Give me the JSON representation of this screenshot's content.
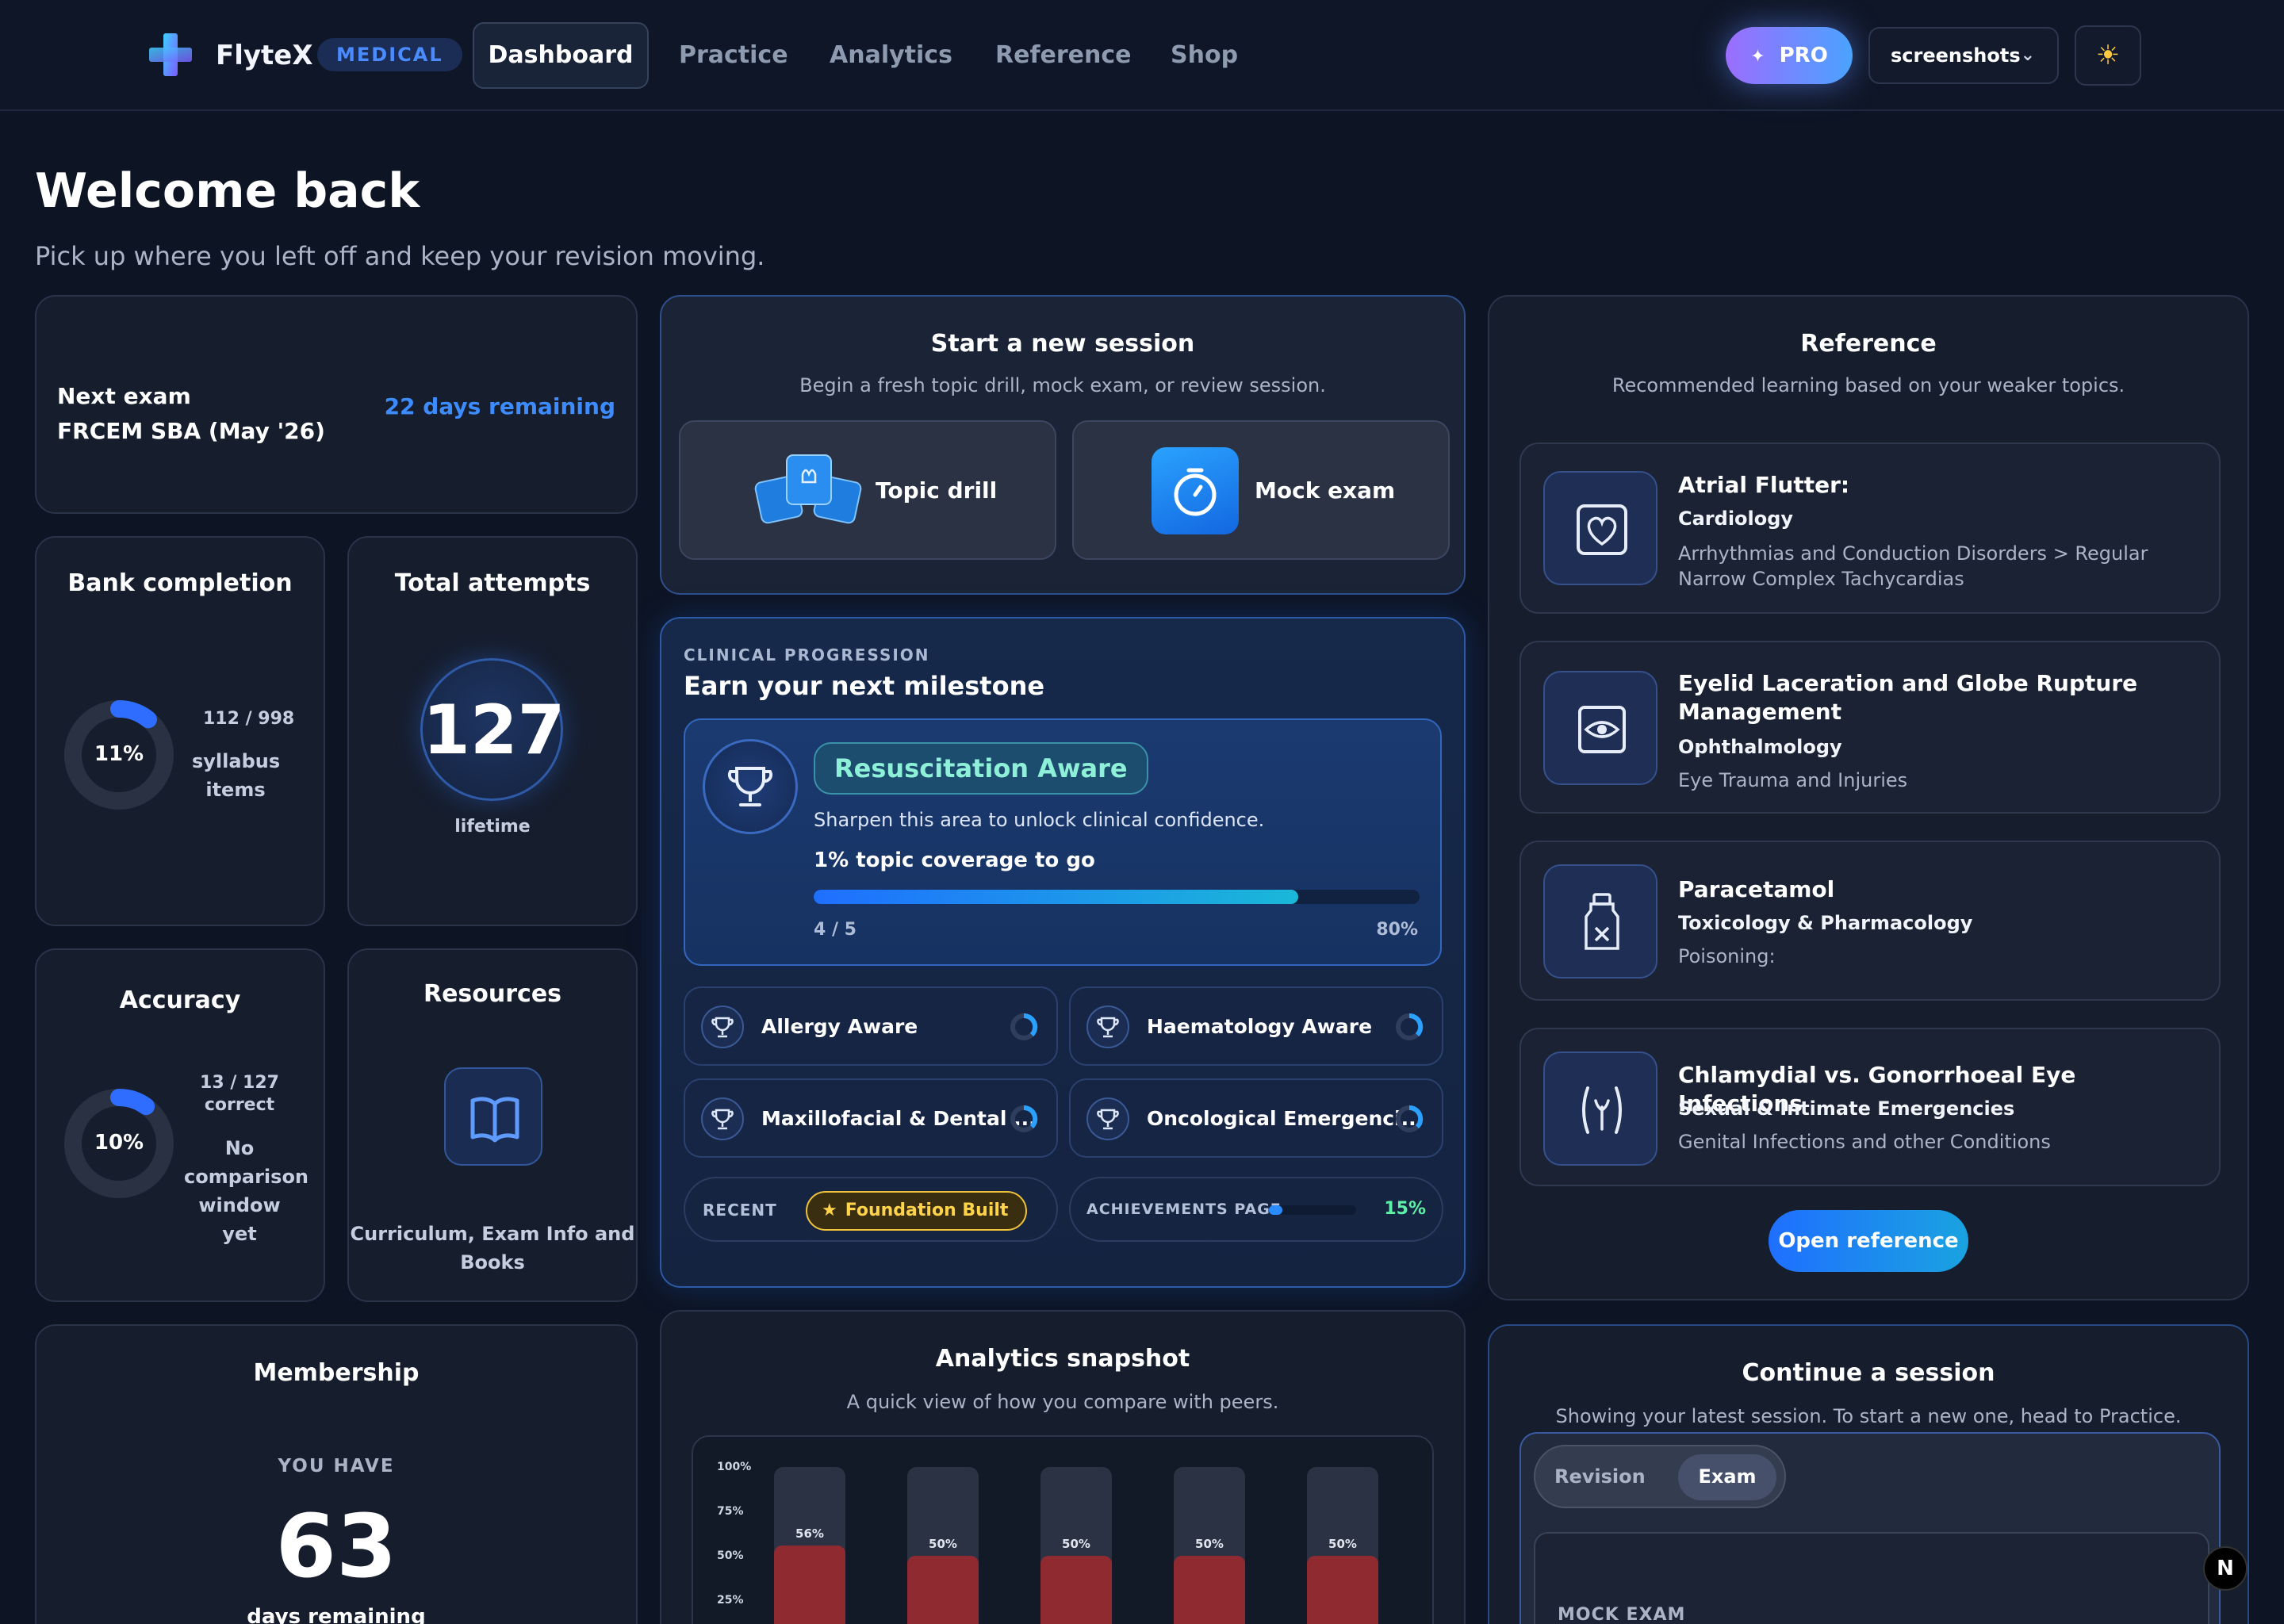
{
  "nav": {
    "brand": "FlyteX",
    "badge": "MEDICAL",
    "links": [
      "Dashboard",
      "Practice",
      "Analytics",
      "Reference",
      "Shop"
    ],
    "pro_label": "PRO",
    "account_label": "screenshots",
    "theme_icon": "sun-icon"
  },
  "header": {
    "title": "Welcome back",
    "subtitle": "Pick up where you left off and keep your revision moving."
  },
  "next_exam": {
    "label": "Next exam",
    "exam": "FRCEM SBA (May '26)",
    "days": "22 days remaining"
  },
  "bank": {
    "title": "Bank completion",
    "percent_text": "11%",
    "percent": 0.11,
    "count": "112 / 998",
    "unit_line1": "syllabus",
    "unit_line2": "items"
  },
  "attempts": {
    "title": "Total attempts",
    "value": "127",
    "caption": "lifetime"
  },
  "accuracy": {
    "title": "Accuracy",
    "percent_text": "10%",
    "percent": 0.1,
    "count": "13 / 127",
    "count_label": "correct",
    "note1": "No",
    "note2": "comparison",
    "note3": "window yet"
  },
  "resources": {
    "title": "Resources",
    "caption1": "Curriculum, Exam Info and",
    "caption2": "Books"
  },
  "session": {
    "title": "Start a new session",
    "subtitle": "Begin a fresh topic drill, mock exam, or review session.",
    "topic_drill": "Topic drill",
    "mock_exam": "Mock exam"
  },
  "progression": {
    "eyebrow": "CLINICAL PROGRESSION",
    "title": "Earn your next milestone",
    "milestone": "Resuscitation Aware",
    "milestone_sub": "Sharpen this area to unlock clinical confidence.",
    "to_go": "1% topic coverage to go",
    "fraction": "4 / 5",
    "percent_text": "80%",
    "progress": 0.8,
    "others": [
      {
        "label": "Allergy Aware"
      },
      {
        "label": "Haematology Aware"
      },
      {
        "label": "Maxillofacial & Dental ..."
      },
      {
        "label": "Oncological Emergenci..."
      }
    ],
    "recent_label": "RECENT",
    "recent_badge": "Foundation Built",
    "ach_label": "ACHIEVEMENTS PAGE",
    "ach_percent_text": "15%",
    "ach_progress": 0.15
  },
  "reference": {
    "title": "Reference",
    "subtitle": "Recommended learning based on your weaker topics.",
    "items": [
      {
        "title": "Atrial Flutter:",
        "category": "Cardiology",
        "sub": "Arrhythmias and Conduction Disorders > Regular Narrow Complex Tachycardias",
        "icon": "heart-icon"
      },
      {
        "title": "Eyelid Laceration and Globe Rupture Management",
        "category": "Ophthalmology",
        "sub": "Eye Trauma and Injuries",
        "icon": "eye-icon"
      },
      {
        "title": "Paracetamol",
        "category": "Toxicology & Pharmacology",
        "sub": "Poisoning:",
        "icon": "poison-bottle-icon"
      },
      {
        "title": "Chlamydial vs. Gonorrhoeal Eye Infections",
        "category": "Sexual & Intimate Emergencies",
        "sub": "Genital Infections and other Conditions",
        "icon": "genital-icon"
      }
    ],
    "button": "Open reference"
  },
  "membership": {
    "title": "Membership",
    "you_have": "YOU HAVE",
    "days": "63",
    "days_label": "days remaining"
  },
  "analytics": {
    "title": "Analytics snapshot",
    "subtitle": "A quick view of how you compare with peers."
  },
  "continue": {
    "title": "Continue a session",
    "subtitle": "Showing your latest session. To start a new one, head to Practice.",
    "tabs": [
      "Revision",
      "Exam"
    ],
    "active_tab": "Exam",
    "session_label": "MOCK EXAM"
  },
  "chart_data": {
    "type": "bar",
    "ylim": [
      0,
      100
    ],
    "y_ticks": [
      "100%",
      "75%",
      "50%",
      "25%"
    ],
    "values": [
      56,
      50,
      50,
      50,
      50
    ],
    "value_labels": [
      "56%",
      "50%",
      "50%",
      "50%",
      "50%"
    ]
  },
  "fab": "N"
}
